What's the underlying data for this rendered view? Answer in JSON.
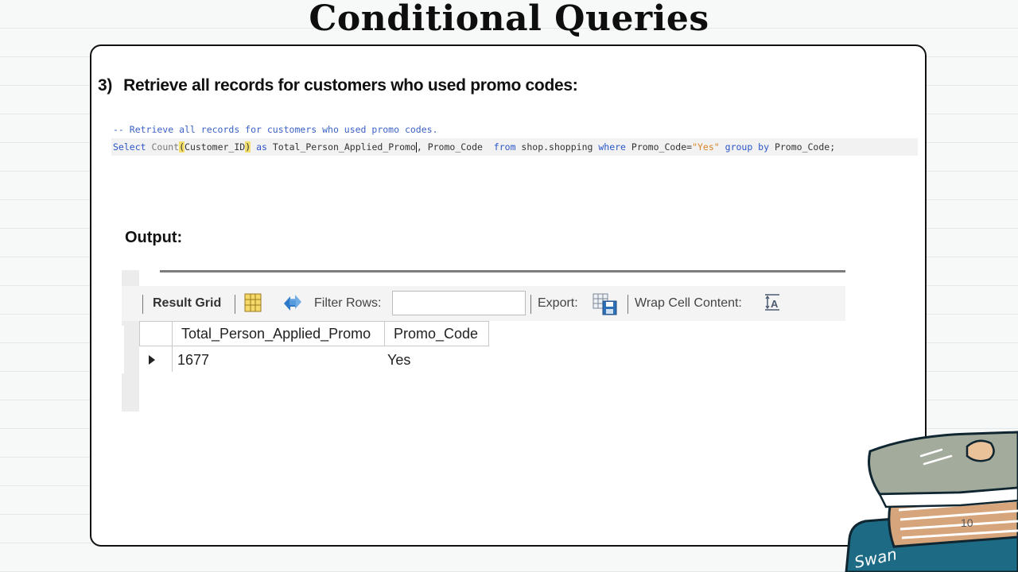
{
  "slide": {
    "title": "Conditional Queries",
    "page_number": "10"
  },
  "question": {
    "number": "3)",
    "text": "Retrieve all records for customers who used promo codes:"
  },
  "code": {
    "comment": "-- Retrieve all records for customers who used promo codes.",
    "tokens": {
      "select": "Select ",
      "count": "Count",
      "open_paren": "(",
      "count_arg": "Customer_ID",
      "close_paren": ")",
      "as": " as ",
      "alias_before_caret": "Total_Person_Applied_Promo",
      "after_caret": ", Promo_Code  ",
      "from": "from",
      "table": " shop.shopping ",
      "where": "where",
      "condition": " Promo_Code=",
      "string_value": "\"Yes\"",
      "space": " ",
      "group_by": "group by",
      "group_col": " Promo_Code;"
    }
  },
  "output_label": "Output:",
  "result_panel": {
    "toolbar": {
      "result_grid_label": "Result Grid",
      "filter_rows_label": "Filter Rows:",
      "filter_rows_value": "",
      "export_label": "Export:",
      "wrap_label": "Wrap Cell Content:"
    },
    "columns": [
      "Total_Person_Applied_Promo",
      "Promo_Code"
    ],
    "rows": [
      [
        "1677",
        "Yes"
      ]
    ]
  },
  "decoration": {
    "book_text": "Swan"
  },
  "colors": {
    "keyword": "#2c56c7",
    "string": "#d9852a",
    "comment": "#3a62c4",
    "paren_highlight": "#f3df6e",
    "book_teal": "#1d6a85",
    "book_gray": "#a3ab9c",
    "book_tan": "#d6a57c"
  }
}
